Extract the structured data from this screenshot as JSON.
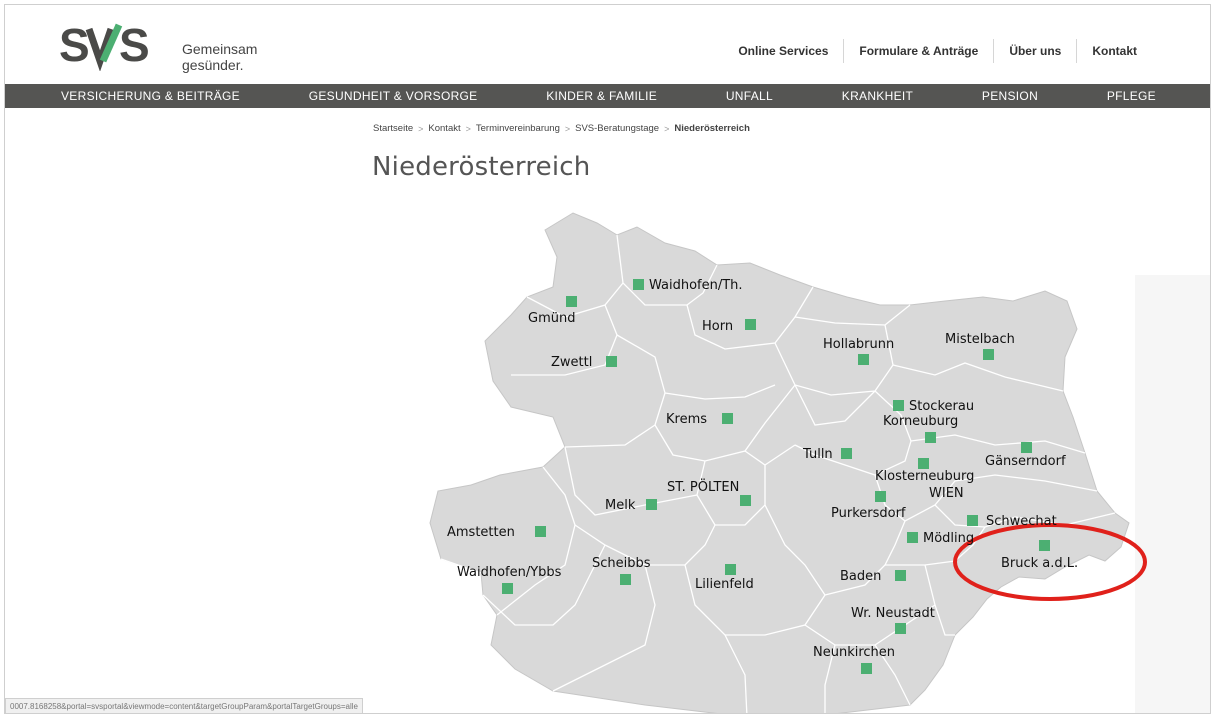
{
  "header": {
    "logo_text": "SVS",
    "tagline_line1": "Gemeinsam",
    "tagline_line2": "gesünder.",
    "top_links": [
      "Online Services",
      "Formulare & Anträge",
      "Über uns",
      "Kontakt"
    ]
  },
  "nav": {
    "items": [
      "VERSICHERUNG & BEITRÄGE",
      "GESUNDHEIT & VORSORGE",
      "KINDER & FAMILIE",
      "UNFALL",
      "KRANKHEIT",
      "PENSION",
      "PFLEGE"
    ]
  },
  "breadcrumb": {
    "items": [
      "Startseite",
      "Kontakt",
      "Terminvereinbarung",
      "SVS-Beratungstage",
      "Niederösterreich"
    ],
    "separator": ">"
  },
  "page": {
    "title": "Niederösterreich"
  },
  "map": {
    "region": "Niederösterreich",
    "fill_color": "#d9d9d9",
    "border_color": "#ffffff",
    "marker_color": "#4caf72",
    "highlight_color": "#e0211b",
    "highlighted_location": "Bruck a.d.L.",
    "locations": [
      "Waidhofen/Th.",
      "Gmünd",
      "Horn",
      "Hollabrunn",
      "Mistelbach",
      "Zwettl",
      "Stockerau",
      "Korneuburg",
      "Krems",
      "Tulln",
      "Gänserndorf",
      "Klosterneuburg",
      "WIEN",
      "ST. PÖLTEN",
      "Melk",
      "Purkersdorf",
      "Schwechat",
      "Amstetten",
      "Mödling",
      "Bruck a.d.L.",
      "Scheibbs",
      "Waidhofen/Ybbs",
      "Baden",
      "Lilienfeld",
      "Wr. Neustadt",
      "Neunkirchen"
    ]
  },
  "status_bar": {
    "text": "0007.8168258&portal=svsportal&viewmode=content&targetGroupParam&portalTargetGroups=alle"
  }
}
